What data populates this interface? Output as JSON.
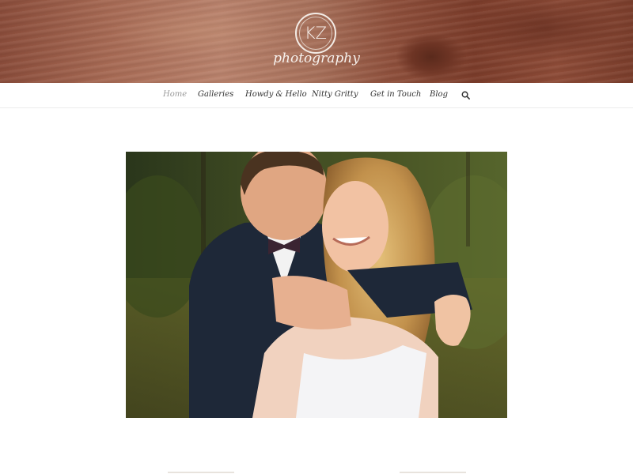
{
  "brand": {
    "monogram": "KZ",
    "tagline": "photography"
  },
  "nav": {
    "items": [
      {
        "label": "Home",
        "active": true
      },
      {
        "label": "Galleries",
        "active": false
      },
      {
        "label": "Howdy & Hello",
        "active": false
      },
      {
        "label": "Nitty Gritty",
        "active": false
      },
      {
        "label": "Get in Touch",
        "active": false
      },
      {
        "label": "Blog",
        "active": false
      }
    ],
    "search_icon": "search-icon"
  },
  "hero_image": {
    "subject": "wedding couple embracing outdoors"
  },
  "colors": {
    "wood": "#9a5a45",
    "nav_text": "#333333",
    "nav_active": "#9a9a9a"
  }
}
